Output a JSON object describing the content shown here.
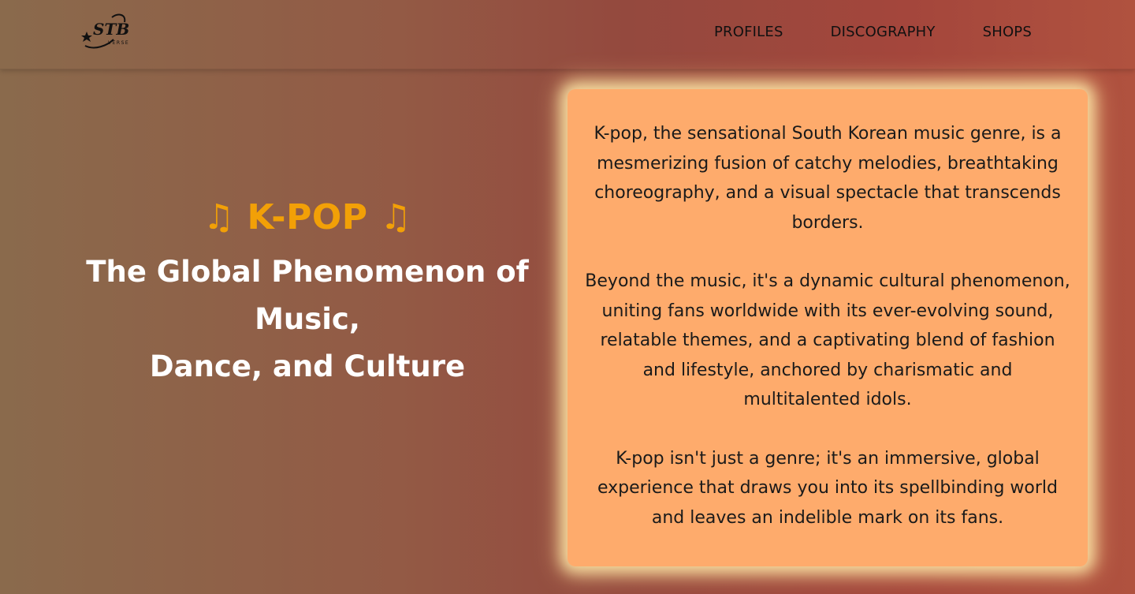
{
  "logo": {
    "text": "STB",
    "subtext": "VERSE"
  },
  "nav": {
    "links": [
      "PROFILES",
      "DISCOGRAPHY",
      "SHOPS"
    ]
  },
  "hero": {
    "note_icon": "♫",
    "title": "K-POP",
    "subtitle_lines": [
      "The Global Phenomenon of",
      "Music,",
      "Dance, and Culture"
    ]
  },
  "card": {
    "paragraphs": [
      "K-pop, the sensational South Korean music genre, is a mesmerizing fusion of catchy melodies, breathtaking choreography, and a visual spectacle that transcends borders.",
      "Beyond the music, it's a dynamic cultural phenomenon, uniting fans worldwide with its ever-evolving sound, relatable themes, and a captivating blend of fashion and lifestyle, anchored by charismatic and multitalented idols.",
      "K-pop isn't just a genre; it's an immersive, global experience that draws you into its spellbinding world and leaves an indelible mark on its fans."
    ]
  },
  "colors": {
    "accent": "#f2a007",
    "card_bg": "#feab6c",
    "heading": "#ffffff"
  }
}
